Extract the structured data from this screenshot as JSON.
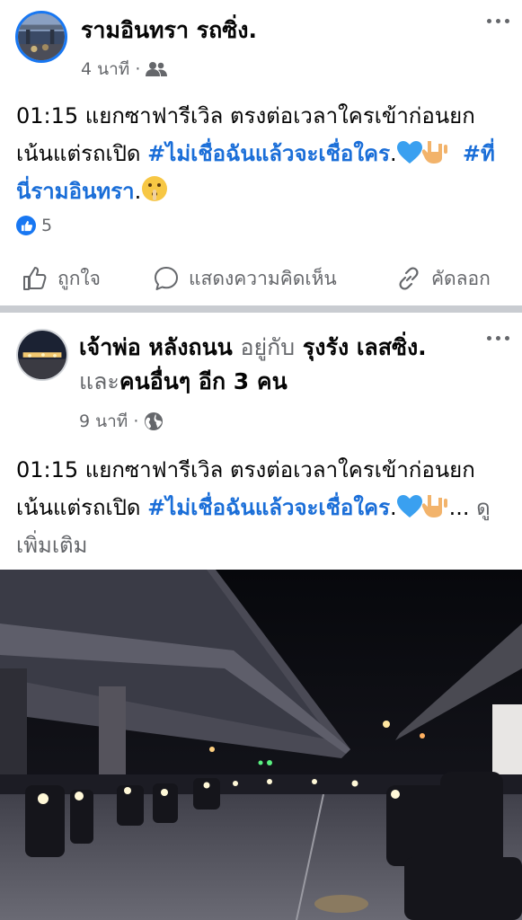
{
  "posts": [
    {
      "author": "รามอินทรา รถซิ่ง.",
      "time": "4 นาที",
      "audience_icon": "friends-icon",
      "text_plain": "01:15 แยกซาฟารีเวิล ตรงต่อเวลาใครเข้าก่อนยก เน้นแต่รถเปิด ",
      "hashtag1": "#ไม่เชื่อฉันแล้วจะเชื่อใคร",
      "dot1": ".",
      "hashtag2": "#ที่นี่รามอินทรา",
      "dot2": ".",
      "reaction_count": "5",
      "actions": {
        "like": "ถูกใจ",
        "comment": "แสดงความคิดเห็น",
        "copy": "คัดลอก"
      }
    },
    {
      "author": "เจ้าพ่อ หลังถนน",
      "with_text": "อยู่กับ",
      "tagged": "รุงรัง เลสซิ่ง.",
      "and_text": "และ",
      "others": "คนอื่นๆ อีก 3 คน",
      "time": "9 นาที",
      "audience_icon": "globe-icon",
      "text_plain": "01:15 แยกซาฟารีเวิล ตรงต่อเวลาใครเข้าก่อนยก เน้นแต่รถเปิด ",
      "hashtag1": "#ไม่เชื่อฉันแล้วจะเชื่อใคร",
      "dot1": ".",
      "ellipsis": "...",
      "see_more": "ดูเพิ่มเติม",
      "photo": "night-street-motorcycles-under-overpass"
    }
  ],
  "colors": {
    "hashtag": "#1a6ed8",
    "muted": "#65676b",
    "like_blue": "#1877f2",
    "separator": "#c9ccd1"
  }
}
